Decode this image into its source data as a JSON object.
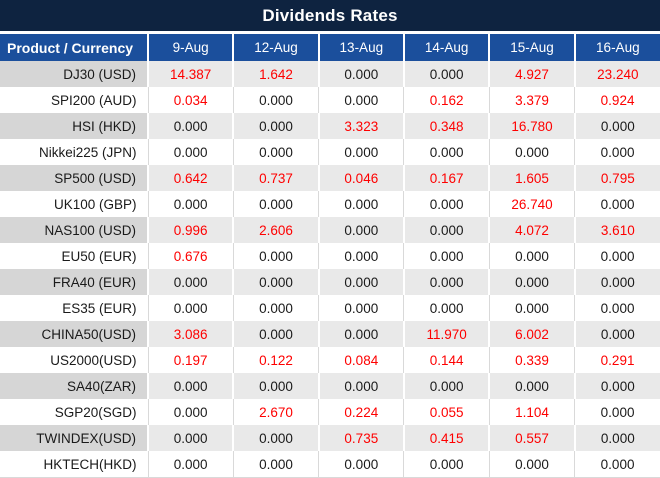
{
  "title": "Dividends Rates",
  "colors": {
    "title_bar_bg": "#0e2340",
    "header_bg": "#1b4f9c",
    "header_text": "#ffffff",
    "gray_row_label_bg": "#d6d6d6",
    "gray_row_value_bg": "#e9e9e9",
    "white_row_bg": "#ffffff",
    "divider_light": "#d9d9d9",
    "nonzero_value_text": "#fe0000",
    "zero_value_text": "#1a1a1a"
  },
  "chart_data": {
    "type": "table",
    "title": "Dividends Rates",
    "row_header_label": "Product / Currency",
    "columns": [
      "9-Aug",
      "12-Aug",
      "13-Aug",
      "14-Aug",
      "15-Aug",
      "16-Aug"
    ],
    "rows": [
      {
        "label": "DJ30 (USD)",
        "values": [
          "14.387",
          "1.642",
          "0.000",
          "0.000",
          "4.927",
          "23.240"
        ]
      },
      {
        "label": "SPI200 (AUD)",
        "values": [
          "0.034",
          "0.000",
          "0.000",
          "0.162",
          "3.379",
          "0.924"
        ]
      },
      {
        "label": "HSI (HKD)",
        "values": [
          "0.000",
          "0.000",
          "3.323",
          "0.348",
          "16.780",
          "0.000"
        ]
      },
      {
        "label": "Nikkei225 (JPN)",
        "values": [
          "0.000",
          "0.000",
          "0.000",
          "0.000",
          "0.000",
          "0.000"
        ]
      },
      {
        "label": "SP500 (USD)",
        "values": [
          "0.642",
          "0.737",
          "0.046",
          "0.167",
          "1.605",
          "0.795"
        ]
      },
      {
        "label": "UK100 (GBP)",
        "values": [
          "0.000",
          "0.000",
          "0.000",
          "0.000",
          "26.740",
          "0.000"
        ]
      },
      {
        "label": "NAS100 (USD)",
        "values": [
          "0.996",
          "2.606",
          "0.000",
          "0.000",
          "4.072",
          "3.610"
        ]
      },
      {
        "label": "EU50 (EUR)",
        "values": [
          "0.676",
          "0.000",
          "0.000",
          "0.000",
          "0.000",
          "0.000"
        ]
      },
      {
        "label": "FRA40 (EUR)",
        "values": [
          "0.000",
          "0.000",
          "0.000",
          "0.000",
          "0.000",
          "0.000"
        ]
      },
      {
        "label": "ES35 (EUR)",
        "values": [
          "0.000",
          "0.000",
          "0.000",
          "0.000",
          "0.000",
          "0.000"
        ]
      },
      {
        "label": "CHINA50(USD)",
        "values": [
          "3.086",
          "0.000",
          "0.000",
          "11.970",
          "6.002",
          "0.000"
        ]
      },
      {
        "label": "US2000(USD)",
        "values": [
          "0.197",
          "0.122",
          "0.084",
          "0.144",
          "0.339",
          "0.291"
        ]
      },
      {
        "label": "SA40(ZAR)",
        "values": [
          "0.000",
          "0.000",
          "0.000",
          "0.000",
          "0.000",
          "0.000"
        ]
      },
      {
        "label": "SGP20(SGD)",
        "values": [
          "0.000",
          "2.670",
          "0.224",
          "0.055",
          "1.104",
          "0.000"
        ]
      },
      {
        "label": "TWINDEX(USD)",
        "values": [
          "0.000",
          "0.000",
          "0.735",
          "0.415",
          "0.557",
          "0.000"
        ]
      },
      {
        "label": "HKTECH(HKD)",
        "values": [
          "0.000",
          "0.000",
          "0.000",
          "0.000",
          "0.000",
          "0.000"
        ]
      }
    ]
  }
}
